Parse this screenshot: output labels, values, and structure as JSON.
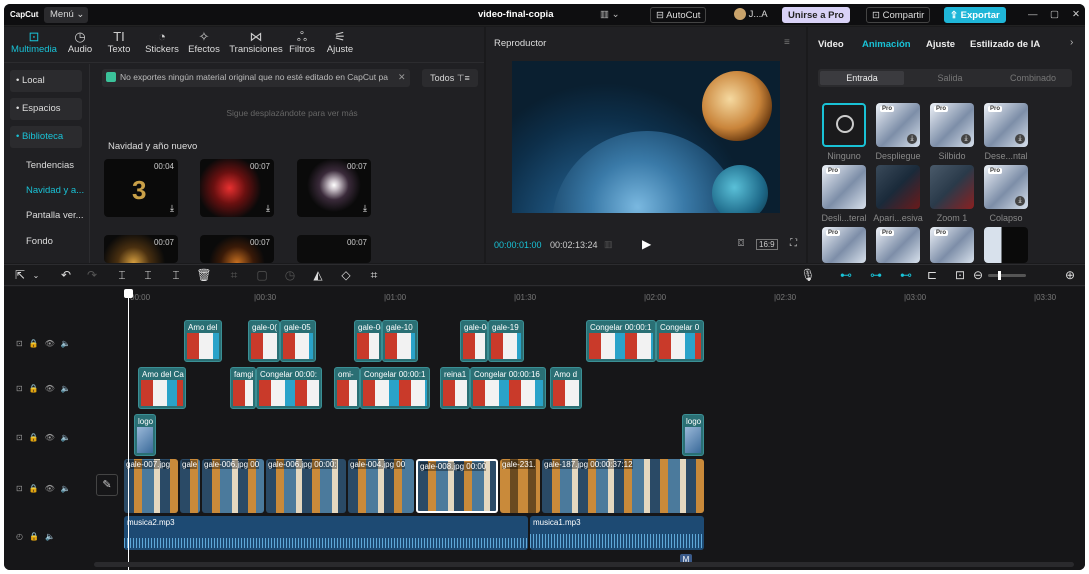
{
  "titlebar": {
    "app_name": "CapCut",
    "menu_label": "Menú",
    "project_name": "video-final-copia",
    "autocut_label": "AutoCut",
    "user_label": "J...A",
    "join_pro_label": "Unirse a Pro",
    "share_label": "Compartir",
    "export_label": "Exportar"
  },
  "media_tabs": [
    {
      "label": "Multimedia",
      "icon": "media-icon"
    },
    {
      "label": "Audio",
      "icon": "audio-icon"
    },
    {
      "label": "Texto",
      "icon": "text-icon"
    },
    {
      "label": "Stickers",
      "icon": "sticker-icon"
    },
    {
      "label": "Efectos",
      "icon": "effects-icon"
    },
    {
      "label": "Transiciones",
      "icon": "transition-icon"
    },
    {
      "label": "Filtros",
      "icon": "filter-icon"
    },
    {
      "label": "Ajuste",
      "icon": "adjust-icon"
    }
  ],
  "sidebar": {
    "items": [
      "• Local",
      "• Espacios",
      "• Biblioteca",
      "Tendencias",
      "Navidad y a...",
      "Pantalla ver...",
      "Fondo"
    ]
  },
  "library": {
    "notice": "No exportes ningún material original que no esté editado en CapCut pa",
    "filter_label": "Todos",
    "scroll_hint": "Sigue desplazándote para ver más",
    "section_title": "Navidad y año nuevo",
    "thumbs": [
      {
        "duration": "00:04"
      },
      {
        "duration": "00:07"
      },
      {
        "duration": "00:07"
      },
      {
        "duration": "00:07"
      },
      {
        "duration": "00:07"
      },
      {
        "duration": "00:07"
      }
    ]
  },
  "player": {
    "title": "Reproductor",
    "current_time": "00:00:01:00",
    "total_time": "00:02:13:24",
    "ratio_label": "16:9"
  },
  "right_panel": {
    "tabs": [
      "Video",
      "Animación",
      "Ajuste",
      "Estilizado de IA"
    ],
    "active_tab": "Animación",
    "subtabs": [
      "Entrada",
      "Salida",
      "Combinado"
    ],
    "animations_row1": [
      "Ninguno",
      "Despliegue",
      "Silbido",
      "Dese...ntal"
    ],
    "animations_row2": [
      "Desli...teral",
      "Apari...esiva",
      "Zoom 1",
      "Colapso"
    ],
    "pro_badge": "Pro"
  },
  "timeline": {
    "ruler": [
      "00:00",
      "|00:30",
      "|01:00",
      "|01:30",
      "|02:00",
      "|02:30",
      "|03:00",
      "|03:30"
    ],
    "track1_clips": [
      "Amo del",
      "gale-0(",
      "gale-05",
      "gale-0(",
      "gale-10",
      "gale-0(",
      "gale-19",
      "Congelar",
      "00:00:1",
      "Congelar",
      "0"
    ],
    "track2_clips": [
      "Amo del Ca",
      "famgi",
      "Congelar",
      "00:00:",
      "omi-",
      "Congelar",
      "00:00:1",
      "reina1",
      "Congelar",
      "00:00:16",
      "Amo d"
    ],
    "logo_clips": [
      "logo",
      "logo"
    ],
    "main_clips": [
      "gale-007.jpg",
      "gale",
      "gale-006.jpg",
      "00",
      "gale-006.jpg",
      "00:00:",
      "gale-004.jpg",
      "00",
      "gale-008.jpg",
      "00:00",
      "gale-231.",
      "gale-187.jpg",
      "00:00:37:12"
    ],
    "audio_clips": [
      "musica2.mp3",
      "musica1.mp3"
    ],
    "marker_label": "M"
  },
  "colors": {
    "accent": "#19c2d6",
    "export": "#1fb6d8",
    "pro_badge": "#d9d2f7",
    "clip": "#2a6f74",
    "audio": "#1d4a73"
  }
}
